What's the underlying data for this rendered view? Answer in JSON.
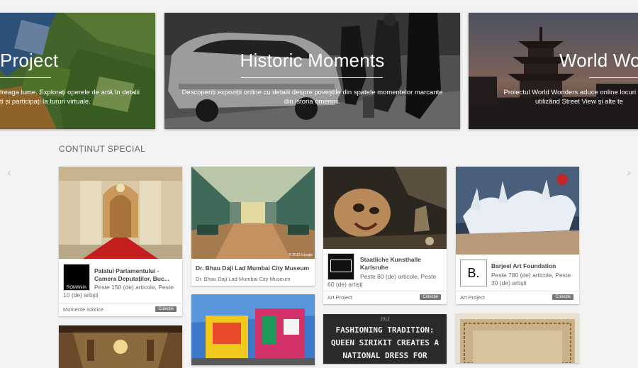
{
  "carousel": {
    "slides": [
      {
        "title": "Project",
        "description": "treaga lume. Explorați operele de artă în detalii\nți și participați la tururi virtuale."
      },
      {
        "title": "Historic Moments",
        "description": "Descoperiți expoziții online cu detalii despre poveștile din spatele momentelor marcante\ndin istoria omenirii."
      },
      {
        "title": "World Wor",
        "description": "Proiectul World Wonders aduce online locuri mode\nutilizând Street View și alte te"
      }
    ]
  },
  "section": {
    "title": "CONȚINUT SPECIAL"
  },
  "cards": [
    {
      "title": "Palatul Parlamentului - Camera Deputaților, Buc...",
      "subtitle": "Peste 150 (de) articole, Peste 10 (de) artiști",
      "logo_text": "ROMANIA",
      "category": "Momente istorice",
      "badge": "Colecție"
    },
    {
      "title": "Dr. Bhau Daji Lad Mumbai City Museum",
      "subtitle": "Dr. Bhau Daji Lad Mumbai City Museum",
      "photo_credit": "© 2013 Google"
    },
    {
      "title": "Staatliche Kunsthalle Karlsruhe",
      "subtitle": "Peste 80 (de) articole, Peste 60 (de) artiști",
      "category": "Art Project",
      "badge": "Colecție"
    },
    {
      "title": "Barjeel Art Foundation",
      "subtitle": "Peste 780 (de) articole, Peste 30 (de) artiști",
      "logo_text": "B.",
      "category": "Art Project",
      "badge": "Colecție"
    },
    {
      "year": "2012",
      "headline_1": "FASHIONING TRADITION:",
      "headline_2": "QUEEN SIRIKIT CREATES A",
      "headline_3": "NATIONAL DRESS FOR"
    }
  ],
  "icons": {
    "nav_left": "chevron-left-icon",
    "nav_right": "chevron-right-icon"
  }
}
